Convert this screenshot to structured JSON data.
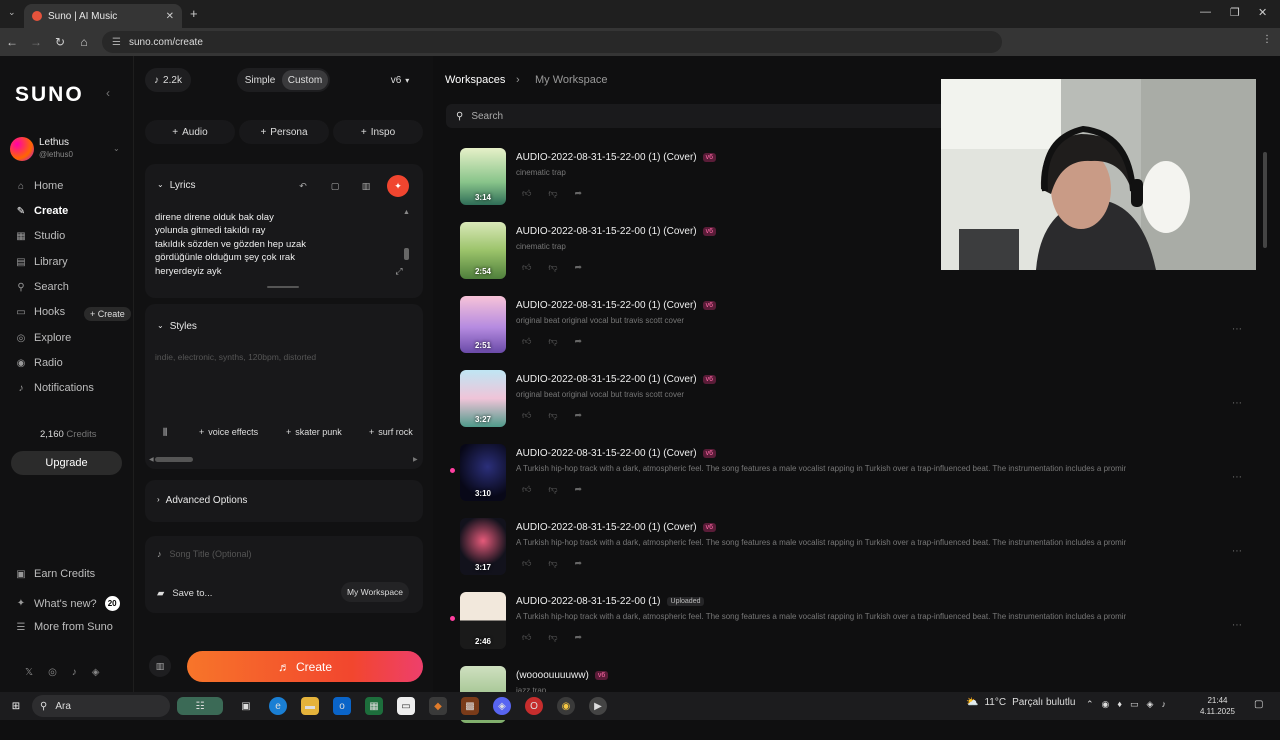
{
  "browser": {
    "tab_title": "Suno | AI Music",
    "url": "suno.com/create"
  },
  "sidebar": {
    "logo": "SUNO",
    "user": {
      "name": "Lethus",
      "handle": "@lethus0"
    },
    "nav": [
      {
        "label": "Home",
        "icon": "home-icon"
      },
      {
        "label": "Create",
        "icon": "create-icon"
      },
      {
        "label": "Studio",
        "icon": "studio-icon"
      },
      {
        "label": "Library",
        "icon": "library-icon"
      },
      {
        "label": "Search",
        "icon": "search-icon"
      },
      {
        "label": "Hooks",
        "icon": "hooks-icon"
      },
      {
        "label": "Explore",
        "icon": "explore-icon"
      },
      {
        "label": "Radio",
        "icon": "radio-icon"
      },
      {
        "label": "Notifications",
        "icon": "bell-icon"
      }
    ],
    "hooks_create": "+ Create",
    "credits_value": "2,160",
    "credits_label": "Credits",
    "upgrade": "Upgrade",
    "bottom": [
      {
        "label": "Earn Credits"
      },
      {
        "label": "What's new?",
        "badge": "20"
      },
      {
        "label": "More from Suno"
      }
    ]
  },
  "panel": {
    "credit_count": "2.2k",
    "mode_simple": "Simple",
    "mode_custom": "Custom",
    "model": "v6",
    "add_audio": "Audio",
    "add_persona": "Persona",
    "add_inspo": "Inspo",
    "lyrics_label": "Lyrics",
    "lyrics": [
      "direne direne olduk bak olay",
      "yolunda gitmedi takıldı ray",
      "takıldık sözden ve gözden hep uzak",
      "gördüğünle olduğum şey çok ırak",
      "heryerdeyiz ayk"
    ],
    "styles_label": "Styles",
    "styles_placeholder": "indie, electronic, synths, 120bpm, distorted",
    "style_tags": [
      "voice effects",
      "skater punk",
      "surf rock"
    ],
    "advanced": "Advanced Options",
    "song_title_placeholder": "Song Title (Optional)",
    "save_to": "Save to...",
    "save_target": "My Workspace",
    "create_button": "Create"
  },
  "workspace": {
    "crumb_root": "Workspaces",
    "crumb_current": "My Workspace",
    "search_placeholder": "Search",
    "songs": [
      {
        "title": "AUDIO-2022-08-31-15-22-00 (1) (Cover)",
        "badge": "v6",
        "desc": "cinematic trap",
        "duration": "3:14"
      },
      {
        "title": "AUDIO-2022-08-31-15-22-00 (1) (Cover)",
        "badge": "v6",
        "desc": "cinematic trap",
        "duration": "2:54"
      },
      {
        "title": "AUDIO-2022-08-31-15-22-00 (1) (Cover)",
        "badge": "v6",
        "desc": "original beat original vocal but travis scott cover",
        "duration": "2:51"
      },
      {
        "title": "AUDIO-2022-08-31-15-22-00 (1) (Cover)",
        "badge": "v6",
        "desc": "original beat original vocal but travis scott cover",
        "duration": "3:27"
      },
      {
        "title": "AUDIO-2022-08-31-15-22-00 (1) (Cover)",
        "badge": "v6",
        "desc": "A Turkish hip-hop track with a dark, atmospheric feel. The song features a male vocalist rapping in Turkish over a trap-influenced beat. The instrumentation includes a prominent, de...",
        "duration": "3:10"
      },
      {
        "title": "AUDIO-2022-08-31-15-22-00 (1) (Cover)",
        "badge": "v6",
        "desc": "A Turkish hip-hop track with a dark, atmospheric feel. The song features a male vocalist rapping in Turkish over a trap-influenced beat. The instrumentation includes a prominent, de...",
        "duration": "3:17"
      },
      {
        "title": "AUDIO-2022-08-31-15-22-00 (1)",
        "badge": "Uploaded",
        "desc": "A Turkish hip-hop track with a dark, atmospheric feel. The song features a male vocalist rapping in Turkish over a trap-influenced beat. The instrumentation includes a prominent, de...",
        "duration": "2:46"
      },
      {
        "title": "(woooouuuuww)",
        "badge": "v6",
        "desc": "jazz trap",
        "duration": ""
      }
    ]
  },
  "taskbar": {
    "search": "Ara",
    "weather": "11°C",
    "weather_desc": "Parçalı bulutlu",
    "time": "21:44",
    "date": "4.11.2025"
  }
}
